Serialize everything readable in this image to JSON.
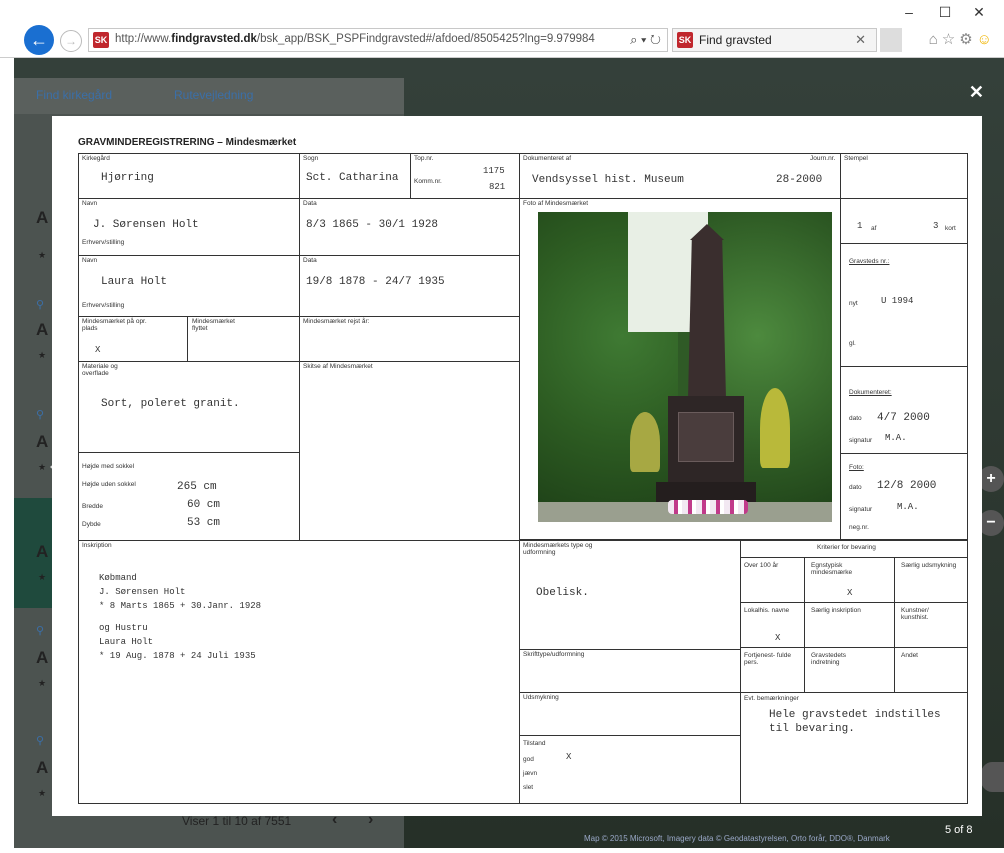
{
  "browser": {
    "url_prefix": "http://www.",
    "url_domain": "findgravsted.dk",
    "url_rest": "/bsk_app/BSK_PSPFindgravsted#/afdoed/8505425?lng=9.979984",
    "tab_title": "Find gravsted",
    "favicon": "SK",
    "window_buttons": {
      "minimize": "–",
      "maximize": "☐",
      "close": "✕"
    },
    "addr_icons": "⌕ ▾ ↻",
    "tab_close": "✕",
    "tool_icons": {
      "home": "⌂",
      "star": "☆",
      "settings": "⚙",
      "smile": "☺"
    }
  },
  "background": {
    "link_find": "Find kirkegård",
    "link_route": "Rutevejledning",
    "pager": "Viser 1 til 10 af 7551",
    "pager_prev": "‹",
    "pager_next": "›",
    "side_letter": "A",
    "side_star": "★",
    "side_pin": "⚲",
    "counter": "5 of 8",
    "map_credit": "Map © 2015 Microsoft, Imagery data © Geodatastyrelsen, Orto forår, DDO®, Danmark",
    "close": "✕",
    "zoom_in": "+",
    "zoom_out": "−"
  },
  "form": {
    "title": "GRAVMINDEREGISTRERING – Mindesmærket",
    "kirkegaard_label": "Kirkegård",
    "kirkegaard": "Hjørring",
    "sogn_label": "Sogn",
    "sogn": "Sct. Catharina",
    "topnr_label": "Top.nr.",
    "topnr": "1175",
    "kommnr_label": "Komm.nr.",
    "kommnr": "821",
    "dokumenteret_af_label": "Dokumenteret af",
    "dokumenteret_af": "Vendsyssel hist. Museum",
    "journr_label": "Journ.nr.",
    "journr": "28-2000",
    "stempel_label": "Stempel",
    "navn_label": "Navn",
    "data_label": "Data",
    "erhverv_label": "Erhverv/stilling",
    "navn1": "J. Sørensen Holt",
    "data1": "8/3 1865 - 30/1 1928",
    "navn2": "Laura Holt",
    "data2": "19/8 1878 - 24/7 1935",
    "foto_label": "Foto af Mindesmærket",
    "kort_num": "1",
    "kort_af": "af",
    "kort_total": "3",
    "kort_label": "kort",
    "gravsted_label": "Gravsteds nr.:",
    "gravsted_nyt_label": "nyt",
    "gravsted_nyt": "U 1994",
    "gravsted_gl_label": "gl.",
    "mind1_label": "Mindesmærket på opr. plads",
    "mind1": "X",
    "mind2_label": "Mindesmærket flyttet",
    "mind3_label": "Mindesmærket rejst år:",
    "materiale_label": "Materiale og overflade",
    "materiale": "Sort, poleret granit.",
    "skitse_label": "Skitse af Mindesmærket",
    "dok_label": "Dokumenteret:",
    "dok_dato_label": "dato",
    "dok_dato": "4/7 2000",
    "dok_sign_label": "signatur",
    "dok_sign": "M.A.",
    "foto_dato_label": "Foto:",
    "foto_dato_lbl": "dato",
    "foto_dato": "12/8 2000",
    "foto_sign_label": "signatur",
    "foto_sign": "M.A.",
    "foto_neg_label": "neg.nr.",
    "hojde_med_label": "Højde med sokkel",
    "hojde_uden_label": "Højde uden sokkel",
    "hojde_uden": "265 cm",
    "bredde_label": "Bredde",
    "bredde": "60 cm",
    "dybde_label": "Dybde",
    "dybde": "53 cm",
    "inskription_label": "Inskription",
    "inskription": [
      "Købmand",
      "J. Sørensen Holt",
      "* 8 Marts 1865  + 30.Janr. 1928",
      "",
      "og Hustru",
      "Laura Holt",
      "* 19 Aug. 1878  + 24 Juli 1935"
    ],
    "type_label": "Mindesmærkets type og udformning",
    "type": "Obelisk.",
    "skrift_label": "Skrifttype/udformning",
    "udsm_label": "Udsmykning",
    "tilstand_label": "Tilstand",
    "tilstand_god": "god",
    "tilstand_god_x": "X",
    "tilstand_jaevn": "jævn",
    "tilstand_slet": "slet",
    "kriterier_label": "Kriterier for bevaring",
    "krit_over100": "Over 100 år",
    "krit_egnstypisk": "Egnstypisk mindesmærke",
    "krit_egnstypisk_x": "X",
    "krit_saerlig_udsm": "Særlig udsmykning",
    "krit_lokal": "Lokalhis. navne",
    "krit_lokal_x": "X",
    "krit_saerlig_inskr": "Særlig inskription",
    "krit_kunst": "Kunstner/ kunsthist.",
    "krit_fortjenst": "Fortjenest- fulde pers.",
    "krit_gravsted": "Gravstedets indretning",
    "krit_andet": "Andet",
    "bemaerk_label": "Evt. bemærkninger",
    "bemaerk1": "Hele gravstedet indstilles",
    "bemaerk2": "til bevaring."
  }
}
